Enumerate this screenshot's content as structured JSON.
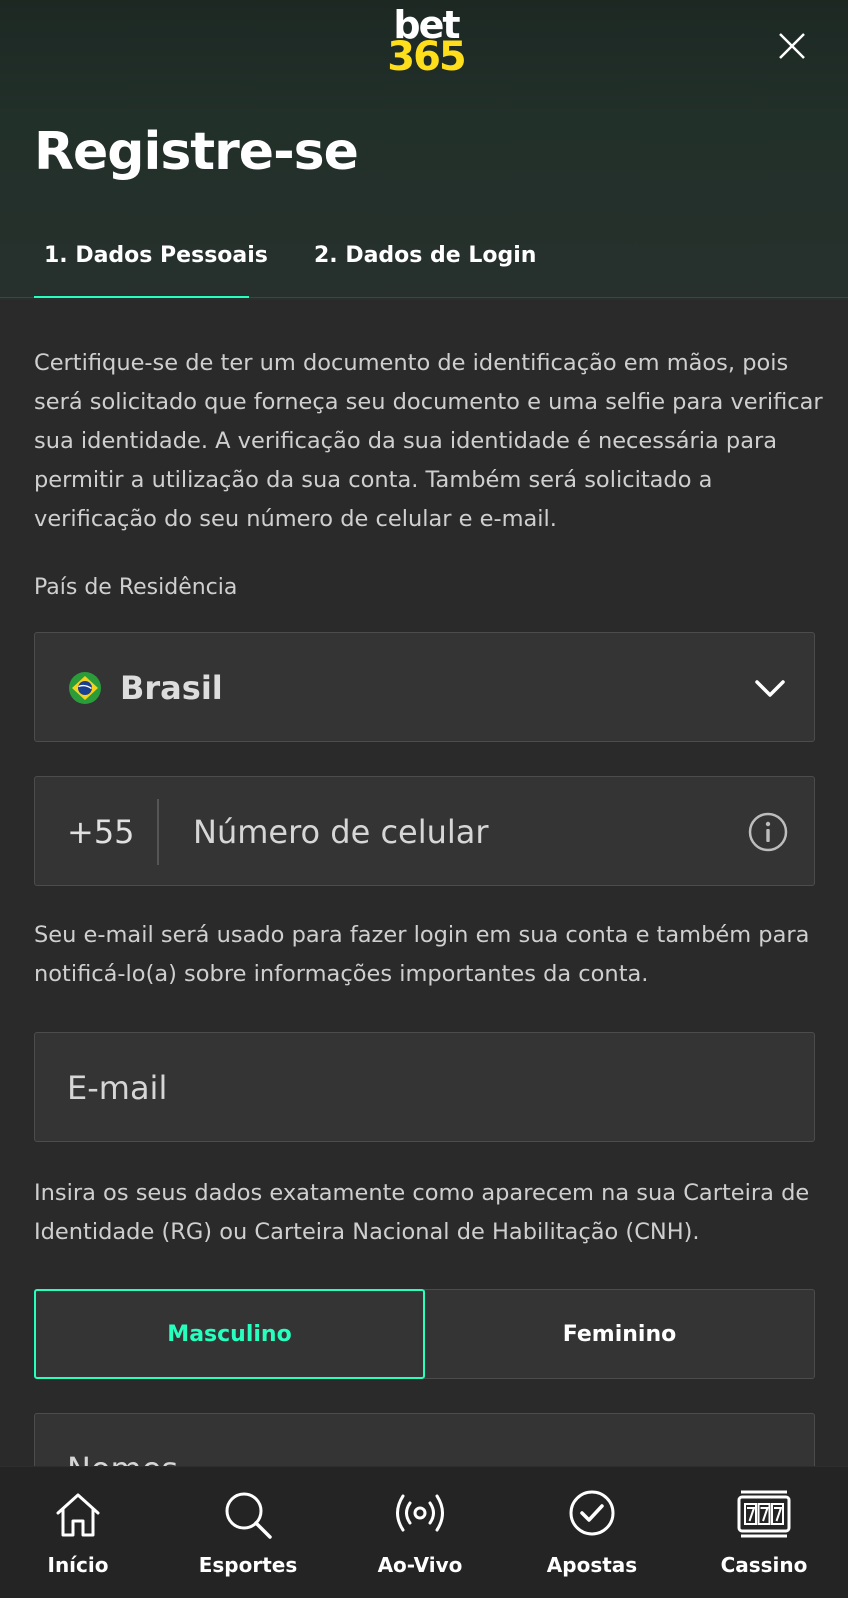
{
  "header": {
    "logo_line1": "bet",
    "logo_line2": "365",
    "close_label": "close"
  },
  "page": {
    "title": "Registre-se"
  },
  "tabs": [
    {
      "label": "1.  Dados Pessoais",
      "active": true
    },
    {
      "label": "2.  Dados de Login",
      "active": false
    }
  ],
  "intro_text": "Certifique-se de ter um documento de identificação em mãos, pois será solicitado que forneça seu documento e uma selfie para verificar sua identidade. A verificação da sua identidade é necessária para permitir a utilização da sua conta. Também será solicitado a verificação do seu número de celular e e-mail.",
  "country": {
    "label": "País de Residência",
    "value": "Brasil",
    "flag_icon": "brazil-flag-icon"
  },
  "phone": {
    "prefix": "+55",
    "placeholder": "Número de celular",
    "value": ""
  },
  "email": {
    "help_text": "Seu e-mail será usado para fazer login em sua conta e também para notificá-lo(a) sobre informações importantes da conta.",
    "placeholder": "E-mail",
    "value": ""
  },
  "identity_text": "Insira os seus dados exatamente como aparecem na sua Carteira de Identidade (RG) ou Carteira Nacional de Habilitação (CNH).",
  "gender": {
    "options": [
      "Masculino",
      "Feminino"
    ],
    "selected": "Masculino"
  },
  "names": {
    "placeholder": "Nomes",
    "value": ""
  },
  "bottom_nav": [
    {
      "label": "Início",
      "icon": "home-icon"
    },
    {
      "label": "Esportes",
      "icon": "search-icon"
    },
    {
      "label": "Ao-Vivo",
      "icon": "live-icon"
    },
    {
      "label": "Apostas",
      "icon": "check-circle-icon"
    },
    {
      "label": "Cassino",
      "icon": "slot-machine-icon"
    }
  ],
  "colors": {
    "accent": "#26ffbe",
    "brand_yellow": "#ffdf1b",
    "background": "#2a2a2a",
    "field": "#343434"
  }
}
